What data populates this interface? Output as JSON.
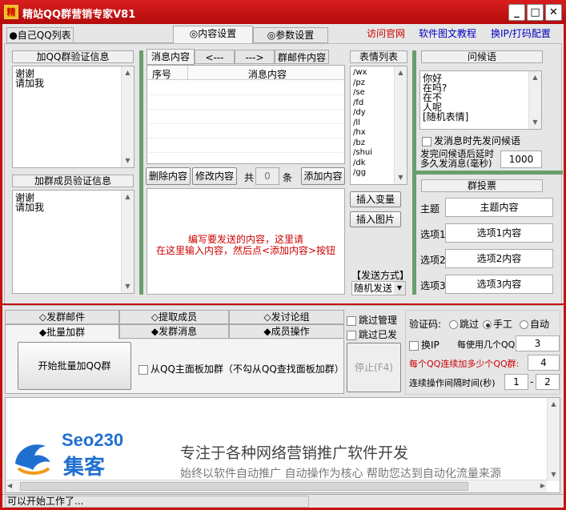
{
  "title": "精站QQ群营销专家V81",
  "logo_char": "精",
  "window_controls": {
    "min": "_",
    "max": "□",
    "close": "✕"
  },
  "top_tabs": [
    "●自己QQ列表",
    "◎内容设置",
    "◎参数设置"
  ],
  "top_links": [
    "访问官网",
    "软件图文教程",
    "换IP/打码配置"
  ],
  "verify_group": {
    "title": "加QQ群验证信息",
    "lines": [
      "谢谢",
      "请加我"
    ]
  },
  "verify_member": {
    "title": "加群成员验证信息",
    "lines": [
      "谢谢",
      "请加我"
    ]
  },
  "msg_tabs": [
    "消息内容",
    "<---",
    "--->",
    "群邮件内容"
  ],
  "msg_table": {
    "col_no": "序号",
    "col_content": "消息内容"
  },
  "msg_buttons": {
    "delete": "删除内容",
    "edit": "修改内容",
    "total_prefix": "共",
    "count": "0",
    "total_suffix": "条",
    "add": "添加内容"
  },
  "compose_hint": [
    "编写要发送的内容，这里请",
    "在这里输入内容，然后点<添加内容>按钮"
  ],
  "emoji": {
    "title": "表情列表",
    "items": [
      "/wx",
      "/pz",
      "/se",
      "/fd",
      "/dy",
      "/ll",
      "/hx",
      "/bz",
      "/shui",
      "/dk",
      "/gg"
    ]
  },
  "insert_var": "插入变量",
  "insert_img": "插入图片",
  "send_mode": {
    "label": "【发送方式】",
    "value": "随机发送"
  },
  "greeting": {
    "title": "问候语",
    "lines": [
      "你好",
      "在吗?",
      "在不",
      "人呢",
      "[随机表情]"
    ],
    "check_label": "发消息时先发问候语",
    "delay_label_1": "发完问候语后延时",
    "delay_label_2": "多久发消息(毫秒)",
    "delay_value": "1000"
  },
  "vote": {
    "title": "群投票",
    "topic_label": "主题",
    "topic_value": "主题内容",
    "options": [
      {
        "label": "选项1",
        "value": "选项1内容"
      },
      {
        "label": "选项2",
        "value": "选项2内容"
      },
      {
        "label": "选项3",
        "value": "选项3内容"
      }
    ]
  },
  "func_tabs_row1": [
    "◇发群邮件",
    "◇提取成员",
    "◇发讨论组"
  ],
  "func_tabs_row2": [
    "◆批量加群",
    "◆发群消息",
    "◆成员操作"
  ],
  "skip_admin": "跳过管理",
  "skip_sent": "跳过已发",
  "start_button": "开始批量加QQ群",
  "main_panel_check": "从QQ主面板加群（不勾从QQ查找面板加群）",
  "stop_button": "停止(F4)",
  "captcha": {
    "label": "验证码:",
    "options": [
      "跳过",
      "手工",
      "自动"
    ],
    "selected": "手工"
  },
  "change_ip": {
    "label": "换IP",
    "per_label": "每使用几个QQ:",
    "value": "3"
  },
  "per_qq_label": "每个QQ连续加多少个QQ群:",
  "per_qq_value": "4",
  "interval_label": "连续操作间隔时间(秒)",
  "interval_from": "1",
  "interval_to": "2",
  "banner": {
    "brand": "Seo230",
    "brand_sub": "集客",
    "headline": "专注于各种网络营销推广软件开发",
    "subline": "始终以软件自动推广 自动操作为核心 帮助您达到自动化流量来源"
  },
  "status": "可以开始工作了..."
}
